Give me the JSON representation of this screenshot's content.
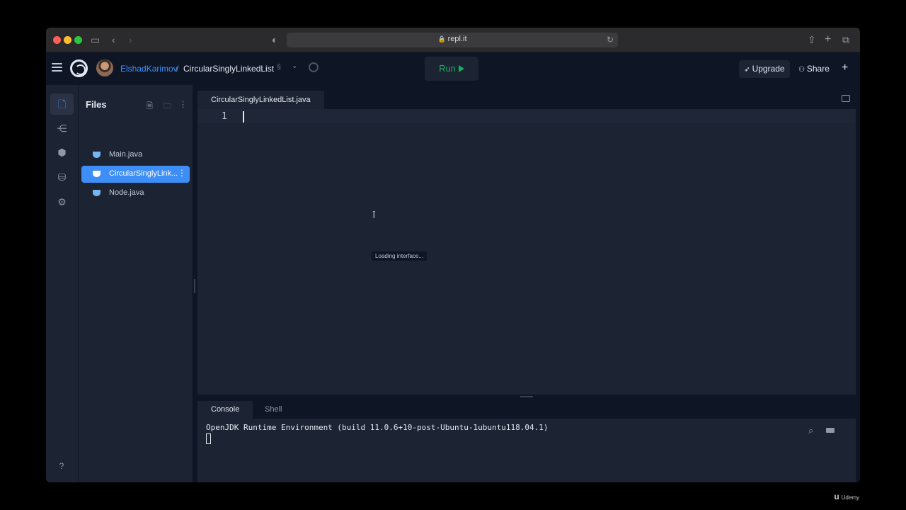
{
  "browser": {
    "url": "repl.it",
    "icons": [
      "sidebar-toggle-icon",
      "back-icon",
      "forward-icon",
      "shield-icon",
      "reload-icon",
      "share-icon",
      "new-tab-icon",
      "tabs-overview-icon"
    ]
  },
  "header": {
    "username": "ElshadKarimov",
    "separator": "/",
    "repl_name": "CircularSinglyLinkedList",
    "run_label": "Run",
    "upgrade_label": "Upgrade",
    "share_label": "Share",
    "plus_label": "+"
  },
  "files_panel": {
    "title": "Files",
    "files": [
      {
        "label": "Main.java",
        "selected": false
      },
      {
        "label": "CircularSinglyLink...",
        "selected": true
      },
      {
        "label": "Node.java",
        "selected": false
      }
    ]
  },
  "editor": {
    "tab_label": "CircularSinglyLinkedList.java",
    "line_number": "1",
    "loading_text": "Loading interface..."
  },
  "console": {
    "tabs": [
      "Console",
      "Shell"
    ],
    "active_tab": "Console",
    "output": "OpenJDK Runtime Environment (build 11.0.6+10-post-Ubuntu-1ubuntu118.04.1)"
  },
  "help_label": "?",
  "watermark": "Udemy",
  "colors": {
    "accent": "#3d8ef7",
    "run_green": "#1aae5f",
    "background": "#1c2333"
  }
}
